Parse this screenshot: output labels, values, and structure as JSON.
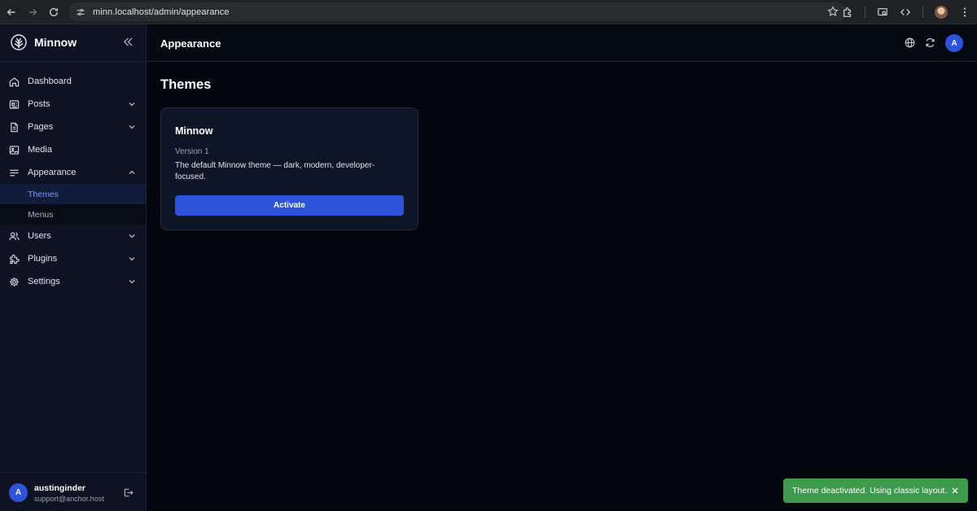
{
  "browser": {
    "url": "minn.localhost/admin/appearance"
  },
  "brand": {
    "name": "Minnow"
  },
  "sidebar": {
    "items": [
      {
        "label": "Dashboard",
        "icon": "home-icon"
      },
      {
        "label": "Posts",
        "icon": "posts-icon"
      },
      {
        "label": "Pages",
        "icon": "pages-icon"
      },
      {
        "label": "Media",
        "icon": "image-icon"
      },
      {
        "label": "Appearance",
        "icon": "appearance-icon"
      },
      {
        "label": "Users",
        "icon": "users-icon"
      },
      {
        "label": "Plugins",
        "icon": "puzzle-icon"
      },
      {
        "label": "Settings",
        "icon": "gear-icon"
      }
    ],
    "appearance_sub": [
      {
        "label": "Themes"
      },
      {
        "label": "Menus"
      }
    ]
  },
  "user": {
    "initial": "A",
    "name": "austinginder",
    "email": "support@anchor.host"
  },
  "header": {
    "title": "Appearance",
    "avatar_initial": "A"
  },
  "main": {
    "title": "Themes",
    "theme_card": {
      "name": "Minnow",
      "version": "Version 1",
      "description": "The default Minnow theme — dark, modern, developer-focused.",
      "button_label": "Activate"
    }
  },
  "toast": {
    "message": "Theme deactivated. Using classic layout."
  },
  "colors": {
    "accent": "#2c53d9",
    "active_nav_text": "#6f97ff",
    "success": "#3f9a4d",
    "background": "#03060f",
    "sidebar": "#0d1322"
  }
}
